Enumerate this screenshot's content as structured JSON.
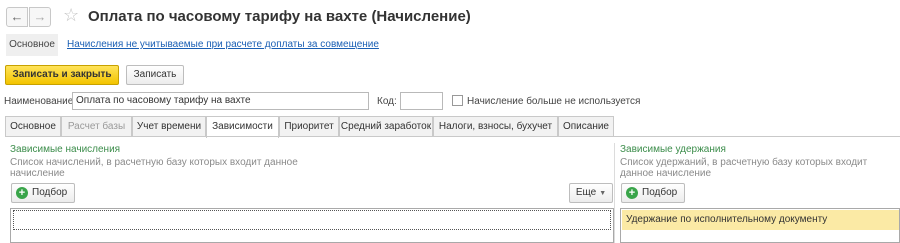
{
  "window": {
    "title": "Оплата по часовому тарифу на вахте (Начисление)",
    "back_icon": "←",
    "forward_icon": "→",
    "star_icon": "☆"
  },
  "sections": {
    "main": "Основное",
    "link": "Начисления не учитываемые при расчете доплаты за совмещение"
  },
  "toolbar": {
    "save_close_label": "Записать и закрыть",
    "save_label": "Записать"
  },
  "form": {
    "name_label": "Наименование:",
    "name_value": "Оплата по часовому тарифу на вахте",
    "code_label": "Код:",
    "code_value": "",
    "unused_label": "Начисление больше не используется"
  },
  "tabs": [
    {
      "label": "Основное",
      "state": "normal"
    },
    {
      "label": "Расчет базы",
      "state": "disabled"
    },
    {
      "label": "Учет времени",
      "state": "normal"
    },
    {
      "label": "Зависимости",
      "state": "active"
    },
    {
      "label": "Приоритет",
      "state": "normal"
    },
    {
      "label": "Средний заработок",
      "state": "normal"
    },
    {
      "label": "Налоги, взносы, бухучет",
      "state": "normal"
    },
    {
      "label": "Описание",
      "state": "normal"
    }
  ],
  "dependent_accruals": {
    "title": "Зависимые начисления",
    "hint": "Список начислений, в расчетную базу которых входит данное начисление",
    "pick_label": "Подбор",
    "more_label": "Еще",
    "more_caret": "▼"
  },
  "dependent_deductions": {
    "title": "Зависимые удержания",
    "hint": "Список удержаний, в расчетную базу которых входит данное начисление",
    "pick_label": "Подбор",
    "rows": [
      "Удержание по исполнительному документу"
    ]
  },
  "colors": {
    "accent_yellow": "#f3c400",
    "group_green": "#3c8d4b",
    "link_blue": "#1a5fb4",
    "selected_row": "#fbeaa5"
  }
}
